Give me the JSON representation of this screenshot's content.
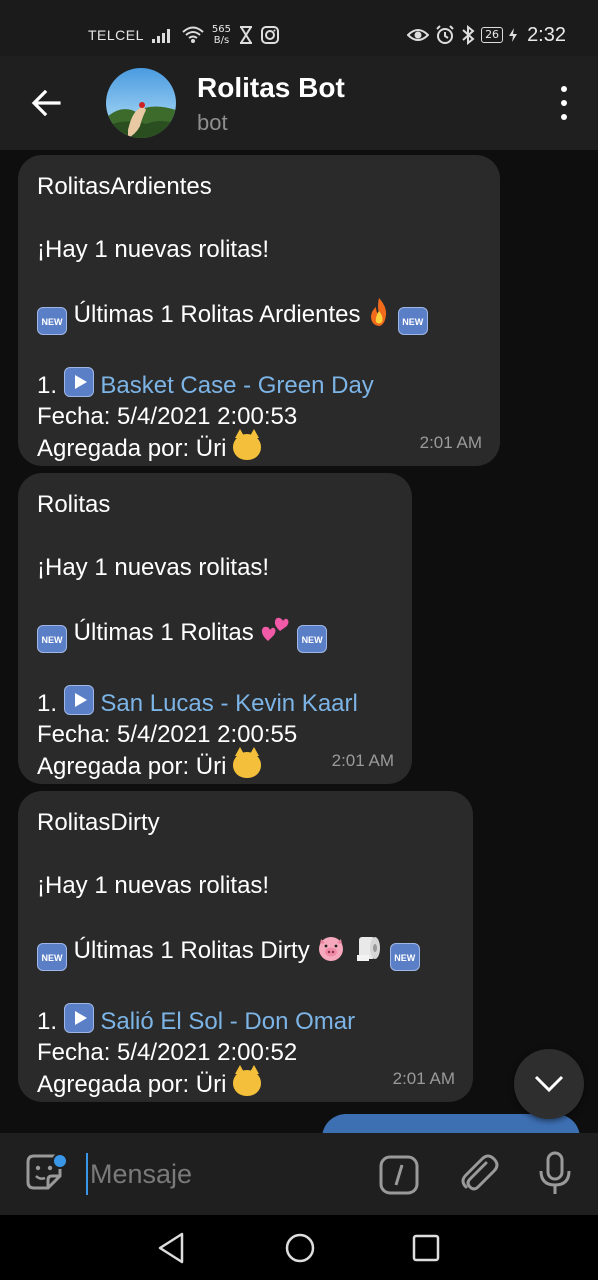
{
  "status_bar": {
    "carrier": "TELCEL",
    "speed_value": "565",
    "speed_unit": "B/s",
    "battery": "26",
    "time": "2:32",
    "icons": [
      "signal-icon",
      "wifi-icon",
      "hourglass-icon",
      "instagram-icon",
      "eye-icon",
      "alarm-icon",
      "bluetooth-icon",
      "battery-icon",
      "charging-icon"
    ]
  },
  "header": {
    "title": "Rolitas Bot",
    "subtitle": "bot"
  },
  "messages": [
    {
      "channel": "RolitasArdientes",
      "announce": "¡Hay 1 nuevas rolitas!",
      "heading": "Últimas 1 Rolitas Ardientes",
      "item_number": "1.",
      "song": "Basket Case - Green Day",
      "fecha": "Fecha: 5/4/2021 2:00:53",
      "agregada_por": "Agregada por: Üri",
      "time": "2:01 AM"
    },
    {
      "channel": "Rolitas",
      "announce": "¡Hay 1 nuevas rolitas!",
      "heading": "Últimas 1 Rolitas",
      "item_number": "1.",
      "song": "San Lucas - Kevin Kaarl",
      "fecha": "Fecha: 5/4/2021 2:00:55",
      "agregada_por": "Agregada por: Üri",
      "time": "2:01 AM"
    },
    {
      "channel": "RolitasDirty",
      "announce": "¡Hay 1 nuevas rolitas!",
      "heading": "Últimas 1 Rolitas Dirty",
      "item_number": "1.",
      "song": "Salió El Sol - Don Omar",
      "fecha": "Fecha: 5/4/2021 2:00:52",
      "agregada_por": "Agregada por: Üri",
      "time": "2:01 AM"
    }
  ],
  "badge_text": "NEW",
  "composer": {
    "placeholder": "Mensaje"
  },
  "colors": {
    "link": "#7cb4e6",
    "bubble": "#2a2a2a",
    "accent": "#3a97e8"
  }
}
